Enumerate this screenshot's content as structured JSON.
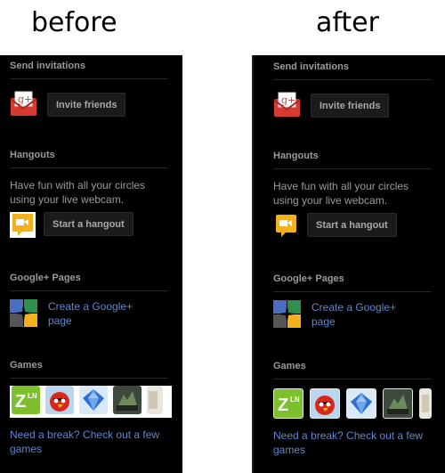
{
  "captions": {
    "before": "before",
    "after": "after"
  },
  "sections": {
    "invite": {
      "title": "Send invitations",
      "button": "Invite friends",
      "icon": "google-plus-mail-icon",
      "icon_text": "g+"
    },
    "hangouts": {
      "title": "Hangouts",
      "description": "Have fun with all your circles using your live webcam.",
      "button": "Start a hangout",
      "icon": "hangout-camera-icon"
    },
    "pages": {
      "title": "Google+ Pages",
      "link": "Create a Google+ page",
      "icon": "google-pages-icon"
    },
    "games": {
      "title": "Games",
      "link": "Need a break? Check out a few games",
      "items": [
        "zynga-game-icon",
        "angry-birds-game-icon",
        "bejeweled-game-icon",
        "dragons-game-icon",
        "partial-game-icon"
      ],
      "logo_text": "Z",
      "logo_text2": "LN"
    }
  },
  "colors": {
    "panel_bg": "#000000",
    "link": "#5d87cc",
    "text_muted": "#9a9a9a",
    "accent_red": "#d73a31",
    "accent_yellow": "#f2b11d"
  }
}
